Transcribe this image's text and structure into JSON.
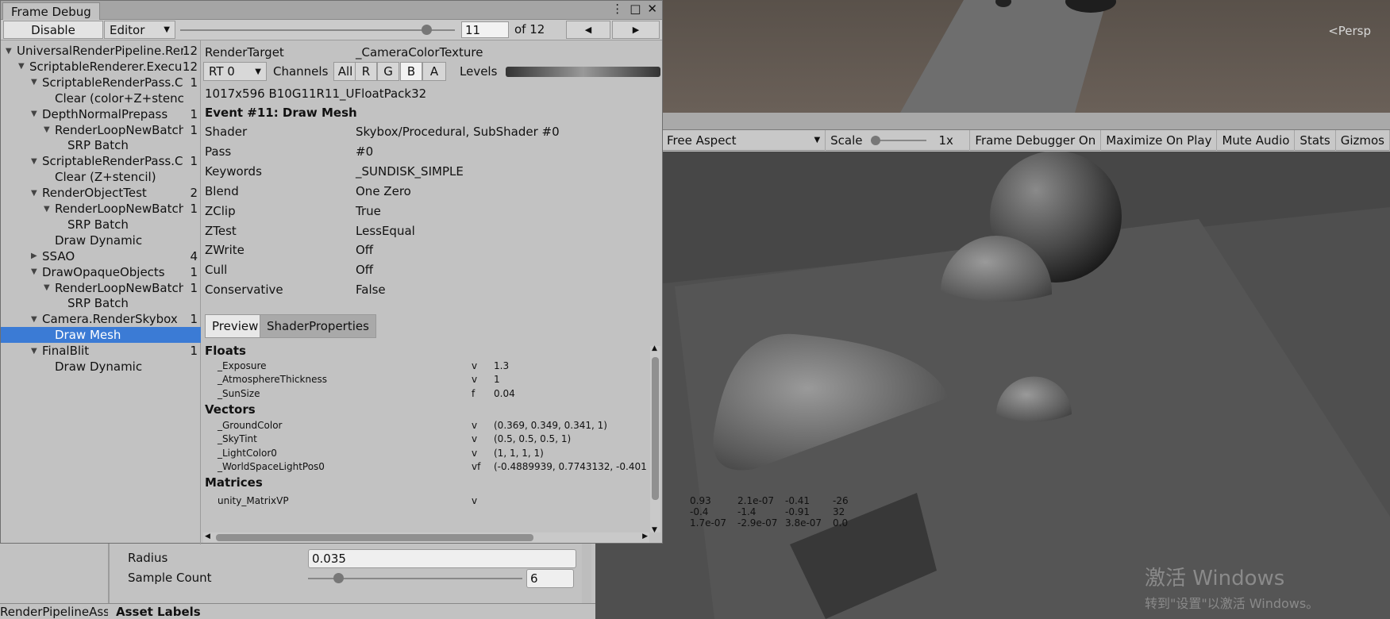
{
  "scene": {
    "persp_label": "<Persp"
  },
  "game_toolbar": {
    "aspect": "Free Aspect",
    "scale_label": "Scale",
    "scale_value": "1x",
    "frame_debugger": "Frame Debugger On",
    "maximize": "Maximize On Play",
    "mute": "Mute Audio",
    "stats": "Stats",
    "gizmos": "Gizmos"
  },
  "watermark": {
    "line1": "激活 Windows",
    "line2": "转到\"设置\"以激活 Windows。"
  },
  "inspector": {
    "radius_label": "Radius",
    "radius_value": "0.035",
    "sample_count_label": "Sample Count",
    "sample_count_value": "6",
    "left_label": "RenderPipelineAss",
    "asset_labels": "Asset Labels"
  },
  "frame_debug": {
    "tab_title": "Frame Debug",
    "toolbar": {
      "disable": "Disable",
      "editor": "Editor",
      "event_index": "11",
      "of_total": "of 12",
      "prev": "◀",
      "next": "▶"
    },
    "tree": [
      {
        "label": "UniversalRenderPipeline.Rer",
        "count": "12",
        "depth": 0,
        "expanded": true
      },
      {
        "label": "ScriptableRenderer.Execu",
        "count": "12",
        "depth": 1,
        "expanded": true
      },
      {
        "label": "ScriptableRenderPass.Cc",
        "count": "1",
        "depth": 2,
        "expanded": true
      },
      {
        "label": "Clear (color+Z+stencil)",
        "count": "",
        "depth": 3,
        "expanded": null
      },
      {
        "label": "DepthNormalPrepass",
        "count": "1",
        "depth": 2,
        "expanded": true
      },
      {
        "label": "RenderLoopNewBatch",
        "count": "1",
        "depth": 3,
        "expanded": true
      },
      {
        "label": "SRP Batch",
        "count": "",
        "depth": 4,
        "expanded": null
      },
      {
        "label": "ScriptableRenderPass.Cc",
        "count": "1",
        "depth": 2,
        "expanded": true
      },
      {
        "label": "Clear (Z+stencil)",
        "count": "",
        "depth": 3,
        "expanded": null
      },
      {
        "label": "RenderObjectTest",
        "count": "2",
        "depth": 2,
        "expanded": true
      },
      {
        "label": "RenderLoopNewBatch",
        "count": "1",
        "depth": 3,
        "expanded": true
      },
      {
        "label": "SRP Batch",
        "count": "",
        "depth": 4,
        "expanded": null
      },
      {
        "label": "Draw Dynamic",
        "count": "",
        "depth": 3,
        "expanded": null
      },
      {
        "label": "SSAO",
        "count": "4",
        "depth": 2,
        "expanded": false
      },
      {
        "label": "DrawOpaqueObjects",
        "count": "1",
        "depth": 2,
        "expanded": true
      },
      {
        "label": "RenderLoopNewBatch",
        "count": "1",
        "depth": 3,
        "expanded": true
      },
      {
        "label": "SRP Batch",
        "count": "",
        "depth": 4,
        "expanded": null
      },
      {
        "label": "Camera.RenderSkybox",
        "count": "1",
        "depth": 2,
        "expanded": true
      },
      {
        "label": "Draw Mesh",
        "count": "",
        "depth": 3,
        "expanded": null,
        "selected": true
      },
      {
        "label": "FinalBlit",
        "count": "1",
        "depth": 2,
        "expanded": true
      },
      {
        "label": "Draw Dynamic",
        "count": "",
        "depth": 3,
        "expanded": null
      }
    ],
    "render_target_label": "RenderTarget",
    "render_target_value": "_CameraColorTexture",
    "rt_select": "RT 0",
    "channels_label": "Channels",
    "channels": [
      "All",
      "R",
      "G",
      "B",
      "A"
    ],
    "channel_selected": "B",
    "levels_label": "Levels",
    "format": "1017x596 B10G11R11_UFloatPack32",
    "event_title": "Event #11: Draw Mesh",
    "props": [
      {
        "key": "Shader",
        "value": "Skybox/Procedural, SubShader #0"
      },
      {
        "key": "Pass",
        "value": "#0"
      },
      {
        "key": "Keywords",
        "value": "_SUNDISK_SIMPLE"
      },
      {
        "key": "Blend",
        "value": "One Zero"
      },
      {
        "key": "ZClip",
        "value": "True"
      },
      {
        "key": "ZTest",
        "value": "LessEqual"
      },
      {
        "key": "ZWrite",
        "value": "Off"
      },
      {
        "key": "Cull",
        "value": "Off"
      },
      {
        "key": "Conservative",
        "value": "False"
      }
    ],
    "subtabs": {
      "preview": "Preview",
      "shader_properties": "ShaderProperties"
    },
    "floats_header": "Floats",
    "floats": [
      {
        "name": "_Exposure",
        "type": "v",
        "value": "1.3"
      },
      {
        "name": "_AtmosphereThickness",
        "type": "v",
        "value": "1"
      },
      {
        "name": "_SunSize",
        "type": "f",
        "value": "0.04"
      }
    ],
    "vectors_header": "Vectors",
    "vectors": [
      {
        "name": "_GroundColor",
        "type": "v",
        "value": "(0.369, 0.349, 0.341, 1)"
      },
      {
        "name": "_SkyTint",
        "type": "v",
        "value": "(0.5, 0.5, 0.5, 1)"
      },
      {
        "name": "_LightColor0",
        "type": "v",
        "value": "(1, 1, 1, 1)"
      },
      {
        "name": "_WorldSpaceLightPos0",
        "type": "vf",
        "value": "(-0.4889939, 0.7743132, -0.401"
      }
    ],
    "matrices_header": "Matrices",
    "matrix_name": "unity_MatrixVP",
    "matrix_type": "v",
    "matrix_rows": [
      [
        "0.93",
        "2.1e-07",
        "-0.41",
        "-26"
      ],
      [
        "-0.4",
        "-1.4",
        "-0.91",
        "32"
      ],
      [
        "1.7e-07",
        "-2.9e-07",
        "3.8e-07",
        "0.0"
      ]
    ]
  },
  "colors": {
    "selection": "#3b7bd5",
    "panel": "#c2c2c2",
    "game_bg": "#474747"
  }
}
